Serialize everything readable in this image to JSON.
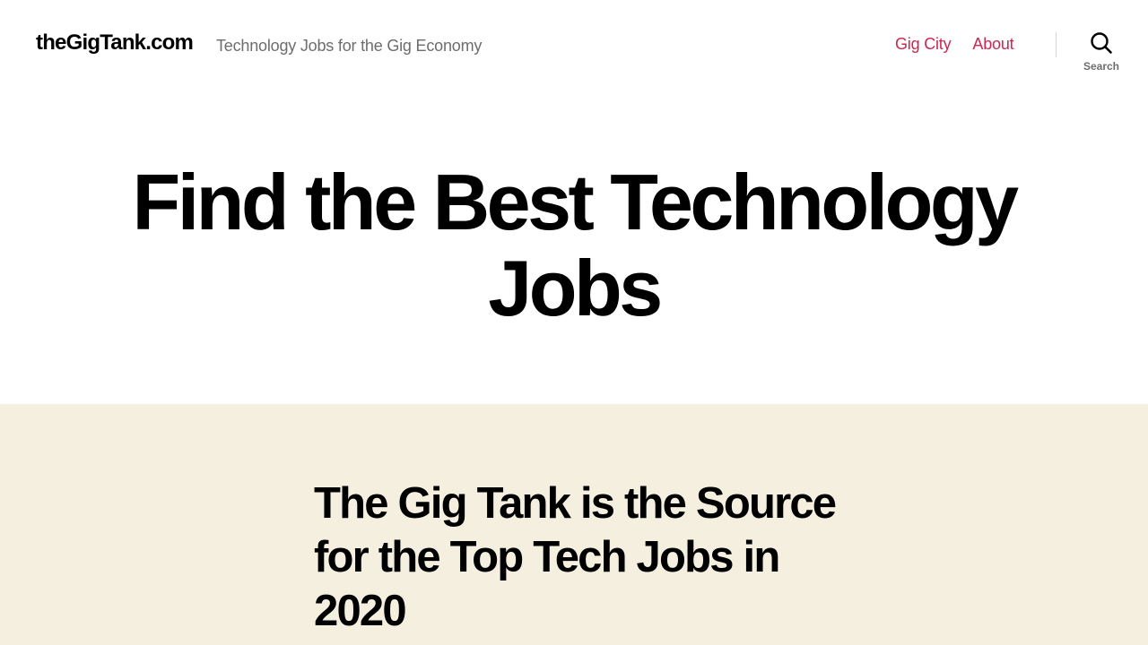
{
  "header": {
    "site_title": "theGigTank.com",
    "site_description": "Technology Jobs for the Gig Economy",
    "nav": [
      {
        "label": "Gig City"
      },
      {
        "label": "About"
      }
    ],
    "search": {
      "icon": "search-icon",
      "label": "Search"
    }
  },
  "hero": {
    "title": "Find the Best Technology Jobs"
  },
  "content": {
    "post_title": "The Gig Tank is the Source for the Top Tech Jobs in 2020"
  },
  "colors": {
    "accent": "#cd2653",
    "text": "#000000",
    "muted": "#6d6d6d",
    "band_background": "#f5efe0"
  }
}
